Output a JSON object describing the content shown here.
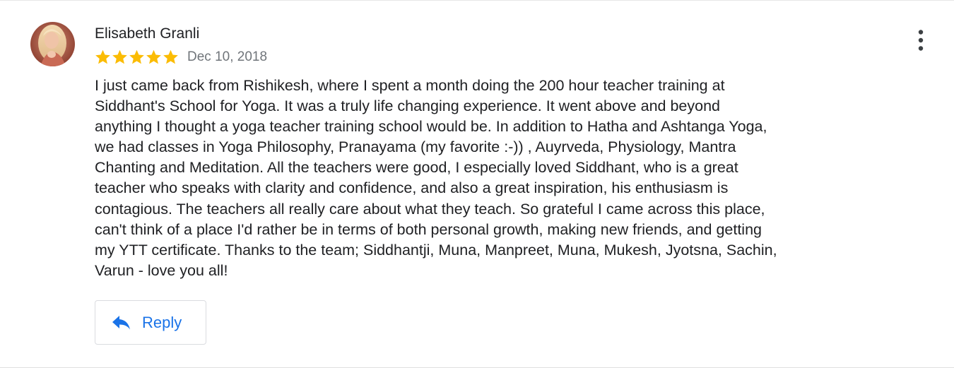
{
  "review": {
    "reviewer_name": "Elisabeth Granli",
    "rating": 5,
    "rating_max": 5,
    "date": "Dec 10, 2018",
    "text": "I just came back from Rishikesh, where I spent a month doing the 200 hour teacher training at\nSiddhant's School for Yoga. It was a truly life changing experience. It went above and beyond\nanything I thought a yoga teacher training school would be. In addition to Hatha and Ashtanga Yoga,\nwe had classes in Yoga Philosophy, Pranayama (my favorite :-)) , Auyrveda, Physiology, Mantra\nChanting and Meditation. All the teachers were good, I especially loved Siddhant, who is a great\nteacher who speaks with clarity and confidence, and also a great inspiration, his enthusiasm is\ncontagious. The teachers all really care about what they teach. So grateful I came across this place,\ncan't think of a place I'd rather be in terms of both personal growth, making new friends, and getting\nmy YTT certificate. Thanks to the team; Siddhantji, Muna, Manpreet, Muna, Mukesh, Jyotsna, Sachin,\nVarun - love you all!",
    "reply_label": "Reply"
  },
  "icons": {
    "avatar": "avatar-photo",
    "star": "star-icon",
    "more": "more-vert-icon",
    "reply": "reply-arrow-icon"
  },
  "colors": {
    "star": "#fbbc04",
    "accent": "#1a73e8",
    "text": "#202124",
    "secondary_text": "#70757a",
    "border": "#dadce0"
  }
}
